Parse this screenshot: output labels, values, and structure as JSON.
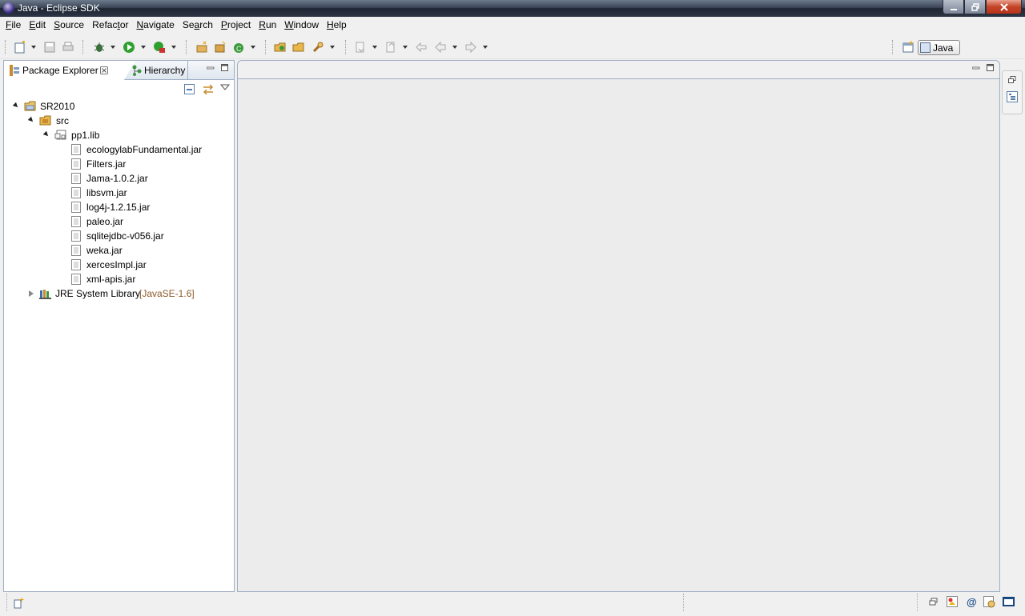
{
  "window": {
    "title": "Java - Eclipse SDK",
    "controls": [
      "minimize",
      "maximize",
      "close"
    ]
  },
  "menubar": [
    {
      "mnemonic": "F",
      "rest": "ile"
    },
    {
      "mnemonic": "E",
      "rest": "dit"
    },
    {
      "mnemonic": "S",
      "rest": "ource"
    },
    {
      "pre": "Refac",
      "mnemonic": "t",
      "rest": "or"
    },
    {
      "mnemonic": "N",
      "rest": "avigate"
    },
    {
      "pre": "Se",
      "mnemonic": "a",
      "rest": "rch"
    },
    {
      "mnemonic": "P",
      "rest": "roject"
    },
    {
      "mnemonic": "R",
      "rest": "un"
    },
    {
      "mnemonic": "W",
      "rest": "indow"
    },
    {
      "mnemonic": "H",
      "rest": "elp"
    }
  ],
  "perspective": {
    "label": "Java"
  },
  "package_explorer": {
    "tabs": [
      {
        "label": "Package Explorer",
        "active": true
      },
      {
        "label": "Hierarchy",
        "active": false
      }
    ],
    "tree": [
      {
        "label": "SR2010",
        "level": 0,
        "expanded": true,
        "icon": "project-icon"
      },
      {
        "label": "src",
        "level": 1,
        "expanded": true,
        "icon": "source-folder-icon"
      },
      {
        "label": "pp1.lib",
        "level": 2,
        "expanded": true,
        "icon": "package-icon"
      },
      {
        "label": "ecologylabFundamental.jar",
        "level": 3,
        "icon": "jar-icon"
      },
      {
        "label": "Filters.jar",
        "level": 3,
        "icon": "jar-icon"
      },
      {
        "label": "Jama-1.0.2.jar",
        "level": 3,
        "icon": "jar-icon"
      },
      {
        "label": "libsvm.jar",
        "level": 3,
        "icon": "jar-icon"
      },
      {
        "label": "log4j-1.2.15.jar",
        "level": 3,
        "icon": "jar-icon"
      },
      {
        "label": "paleo.jar",
        "level": 3,
        "icon": "jar-icon"
      },
      {
        "label": "sqlitejdbc-v056.jar",
        "level": 3,
        "icon": "jar-icon"
      },
      {
        "label": "weka.jar",
        "level": 3,
        "icon": "jar-icon"
      },
      {
        "label": "xercesImpl.jar",
        "level": 3,
        "icon": "jar-icon"
      },
      {
        "label": "xml-apis.jar",
        "level": 3,
        "icon": "jar-icon"
      },
      {
        "label": "JRE System Library",
        "decoration": "[JavaSE-1.6]",
        "level": 1,
        "expanded": false,
        "icon": "library-icon"
      }
    ]
  },
  "colors": {
    "accent_border": "#a0afc3",
    "decoration": "#8b5a2b",
    "editor_bg": "#ececec"
  }
}
